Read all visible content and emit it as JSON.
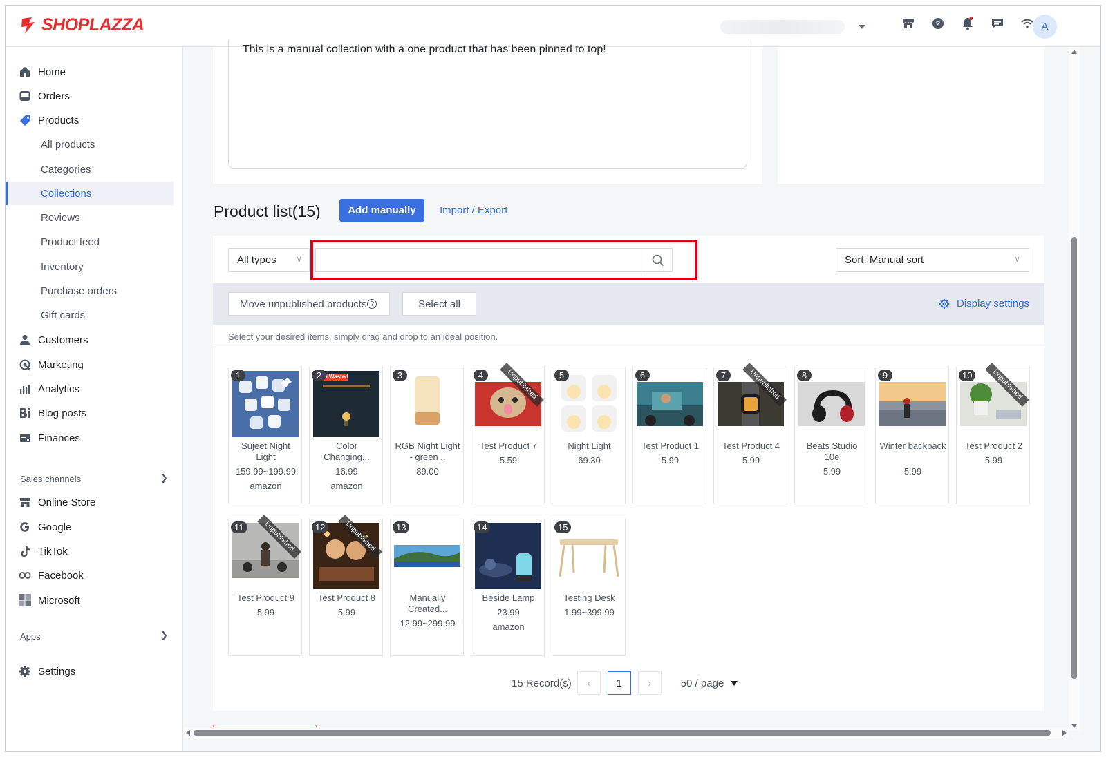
{
  "brand": {
    "name": "SHOPLAZZA",
    "color": "#e62e2e"
  },
  "colors": {
    "accent": "#3a6fe0",
    "highlight": "#d9001b",
    "action_bar": "#e5e8ef"
  },
  "header": {
    "avatar_initial": "A",
    "icons": [
      "store-icon",
      "help-icon",
      "bell-icon",
      "chat-icon",
      "wifi-icon"
    ]
  },
  "sidebar": {
    "items": [
      {
        "label": "Home",
        "icon": "home-icon"
      },
      {
        "label": "Orders",
        "icon": "orders-icon"
      },
      {
        "label": "Products",
        "icon": "tag-icon"
      }
    ],
    "product_subitems": [
      {
        "label": "All products"
      },
      {
        "label": "Categories"
      },
      {
        "label": "Collections",
        "active": true
      },
      {
        "label": "Reviews"
      },
      {
        "label": "Product feed"
      },
      {
        "label": "Inventory"
      },
      {
        "label": "Purchase orders"
      },
      {
        "label": "Gift cards"
      }
    ],
    "items2": [
      {
        "label": "Customers",
        "icon": "user-icon"
      },
      {
        "label": "Marketing",
        "icon": "marketing-icon"
      },
      {
        "label": "Analytics",
        "icon": "analytics-icon"
      },
      {
        "label": "Blog posts",
        "icon": "blog-icon"
      },
      {
        "label": "Finances",
        "icon": "finances-icon"
      }
    ],
    "sales_channels_label": "Sales channels",
    "channels": [
      {
        "label": "Online Store",
        "icon": "store-icon"
      },
      {
        "label": "Google",
        "icon": "google-icon"
      },
      {
        "label": "TikTok",
        "icon": "tiktok-icon"
      },
      {
        "label": "Facebook",
        "icon": "meta-icon"
      },
      {
        "label": "Microsoft",
        "icon": "microsoft-icon"
      }
    ],
    "apps_label": "Apps",
    "settings_label": "Settings"
  },
  "collection": {
    "description": "This is a manual collection with a one product that has been pinned to top!"
  },
  "product_list": {
    "title": "Product list(15)",
    "add_manually_label": "Add manually",
    "import_export_label": "Import / Export",
    "type_filter_value": "All types",
    "search_value": "",
    "sort_value": "Sort: Manual sort",
    "move_unpublished_label": "Move unpublished products",
    "select_all_label": "Select all",
    "display_settings_label": "Display settings",
    "hint": "Select your desired items, simply drag and drop to an ideal position.",
    "unpublished_label": "Unpublished",
    "products": [
      {
        "num": "1",
        "name": "Sujeet Night Light",
        "price": "159.99~199.99",
        "vendor": "amazon",
        "unpublished": false
      },
      {
        "num": "2",
        "name": "Color Changing...",
        "price": "16.99",
        "vendor": "amazon",
        "unpublished": false,
        "banner": "No Wasted"
      },
      {
        "num": "3",
        "name": "RGB Night Light - green ..",
        "price": "89.00",
        "vendor": "",
        "unpublished": false
      },
      {
        "num": "4",
        "name": "Test Product 7",
        "price": "5.59",
        "vendor": "",
        "unpublished": true
      },
      {
        "num": "5",
        "name": "Night Light",
        "price": "69.30",
        "vendor": "",
        "unpublished": false
      },
      {
        "num": "6",
        "name": "Test Product 1",
        "price": "5.99",
        "vendor": "",
        "unpublished": false
      },
      {
        "num": "7",
        "name": "Test Product 4",
        "price": "5.99",
        "vendor": "",
        "unpublished": true
      },
      {
        "num": "8",
        "name": "Beats Studio 10e",
        "price": "5.99",
        "vendor": "",
        "unpublished": false
      },
      {
        "num": "9",
        "name": "Winter backpack",
        "price": "5.99",
        "vendor": "",
        "unpublished": false
      },
      {
        "num": "10",
        "name": "Test Product 2",
        "price": "5.99",
        "vendor": "",
        "unpublished": true
      },
      {
        "num": "11",
        "name": "Test Product 9",
        "price": "5.99",
        "vendor": "",
        "unpublished": true
      },
      {
        "num": "12",
        "name": "Test Product 8",
        "price": "5.99",
        "vendor": "",
        "unpublished": true
      },
      {
        "num": "13",
        "name": "Manually Created...",
        "price": "12.99~299.99",
        "vendor": "",
        "unpublished": false
      },
      {
        "num": "14",
        "name": "Beside Lamp",
        "price": "23.99",
        "vendor": "amazon",
        "unpublished": false
      },
      {
        "num": "15",
        "name": "Testing Desk",
        "price": "1.99~399.99",
        "vendor": "",
        "unpublished": false
      }
    ]
  },
  "pagination": {
    "records": "15 Record(s)",
    "current_page": "1",
    "page_size": "50 / page"
  }
}
